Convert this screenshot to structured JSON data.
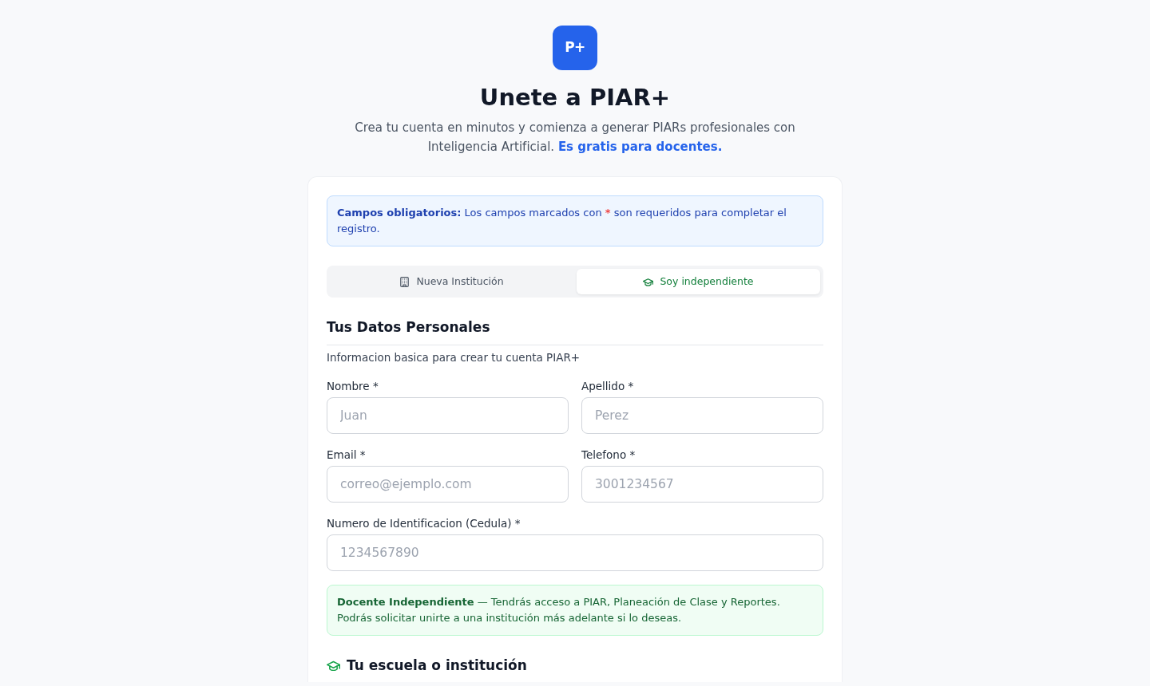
{
  "logo": {
    "text": "P+"
  },
  "title": "Unete a PIAR+",
  "subtitle": "Crea tu cuenta en minutos y comienza a generar PIARs profesionales con Inteligencia Artificial. **Es gratis para docentes.**",
  "required_notice": {
    "before": "**Campos obligatorios:** Los campos marcados con",
    "mark": "*",
    "after": "son requeridos para completar el registro."
  },
  "tabs": [
    {
      "label": "Nueva Institución",
      "selected": false
    },
    {
      "label": "Soy independiente",
      "selected": true
    }
  ],
  "personal_section": {
    "title": "Tus Datos Personales",
    "description": "Informacion basica para crear tu cuenta PIAR+",
    "rows": [
      [
        {
          "label": "Nombre *",
          "placeholder": "Juan"
        },
        {
          "label": "Apellido *",
          "placeholder": "Perez"
        }
      ],
      [
        {
          "label": "Email *",
          "placeholder": "correo@ejemplo.com"
        },
        {
          "label": "Telefono *",
          "placeholder": "3001234567"
        }
      ],
      [
        {
          "label": "Numero de Identificacion (Cedula) *",
          "placeholder": "1234567890"
        }
      ]
    ]
  },
  "independent_notice": "**Docente Independiente** — Tendrás acceso a PIAR, Planeación de Clase y Reportes. Podrás solicitar unirte a una institución más adelante si lo deseas.",
  "institution_section": {
    "title": "Tu escuela o institución"
  }
}
